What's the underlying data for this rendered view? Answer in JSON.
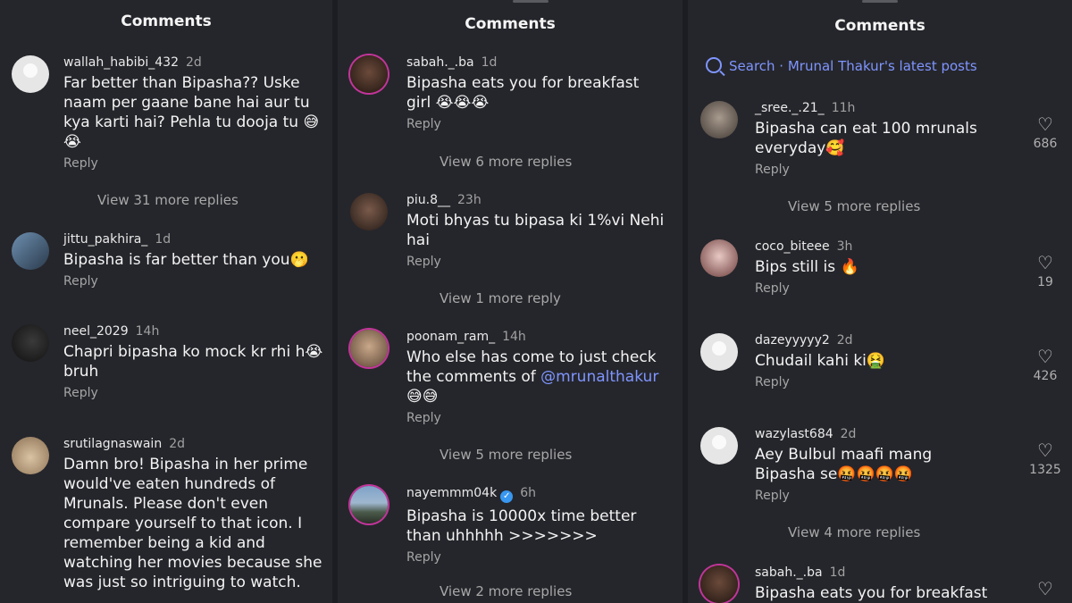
{
  "panel1": {
    "title": "Comments",
    "comments": [
      {
        "user": "wallah_habibi_432",
        "time": "2d",
        "text": "Far better than Bipasha?? Uske naam per gaane bane hai aur tu kya karti hai? Pehla tu dooja tu 😅😭",
        "reply": "Reply",
        "more": "View 31 more replies"
      },
      {
        "user": "jittu_pakhira_",
        "time": "1d",
        "text": "Bipasha is far better than you🫢",
        "reply": "Reply"
      },
      {
        "user": "neel_2029",
        "time": "14h",
        "text": "Chapri bipasha ko mock kr rhi h😭 bruh",
        "reply": "Reply"
      },
      {
        "user": "srutilagnaswain",
        "time": "2d",
        "text": "Damn bro! Bipasha in her prime would've eaten hundreds of Mrunals. Please don't even compare yourself to that icon. I remember being a kid and watching her movies because she was just so intriguing to watch."
      }
    ]
  },
  "panel2": {
    "title": "Comments",
    "comments": [
      {
        "user": "sabah._.ba",
        "time": "1d",
        "text": "Bipasha eats you for breakfast girl 😭😭😭",
        "reply": "Reply",
        "more": "View 6 more replies"
      },
      {
        "user": "piu.8__",
        "time": "23h",
        "text": "Moti bhyas tu bipasa ki 1%vi Nehi hai",
        "reply": "Reply",
        "more": "View 1 more reply"
      },
      {
        "user": "poonam_ram_",
        "time": "14h",
        "text_before": "Who else has come to just check the comments of ",
        "mention": "@mrunalthakur",
        "text_after": "😅😅",
        "reply": "Reply",
        "more": "View 5 more replies"
      },
      {
        "user": "nayemmm04k",
        "time": "6h",
        "verified": true,
        "text": "Bipasha is 10000x time better than uhhhhh >>>>>>>",
        "reply": "Reply",
        "more": "View 2 more replies"
      }
    ]
  },
  "panel3": {
    "title": "Comments",
    "search": "Search · Mrunal Thakur's latest posts",
    "comments": [
      {
        "user": "_sree._.21_",
        "time": "11h",
        "text": "Bipasha can eat 100 mrunals everyday🥰",
        "reply": "Reply",
        "likes": "686",
        "more": "View 5 more replies"
      },
      {
        "user": "coco_biteee",
        "time": "3h",
        "text": "Bips still is 🔥",
        "reply": "Reply",
        "likes": "19"
      },
      {
        "user": "dazeyyyyy2",
        "time": "2d",
        "text": "Chudail kahi ki🤮",
        "reply": "Reply",
        "likes": "426"
      },
      {
        "user": "wazylast684",
        "time": "2d",
        "text": "Aey Bulbul maafi mang Bipasha se🤬🤬🤬🤬",
        "reply": "Reply",
        "likes": "1325",
        "more": "View 4 more replies"
      },
      {
        "user": "sabah._.ba",
        "time": "1d",
        "text": "Bipasha eats you for breakfast"
      }
    ]
  },
  "icons": {
    "heart": "heart-icon",
    "search": "search-icon",
    "verified": "verified-badge-icon"
  },
  "colors": {
    "background": "#25262b",
    "link": "#7f95ff",
    "muted": "#a5a5a5",
    "story_ring": "#c2359a"
  }
}
